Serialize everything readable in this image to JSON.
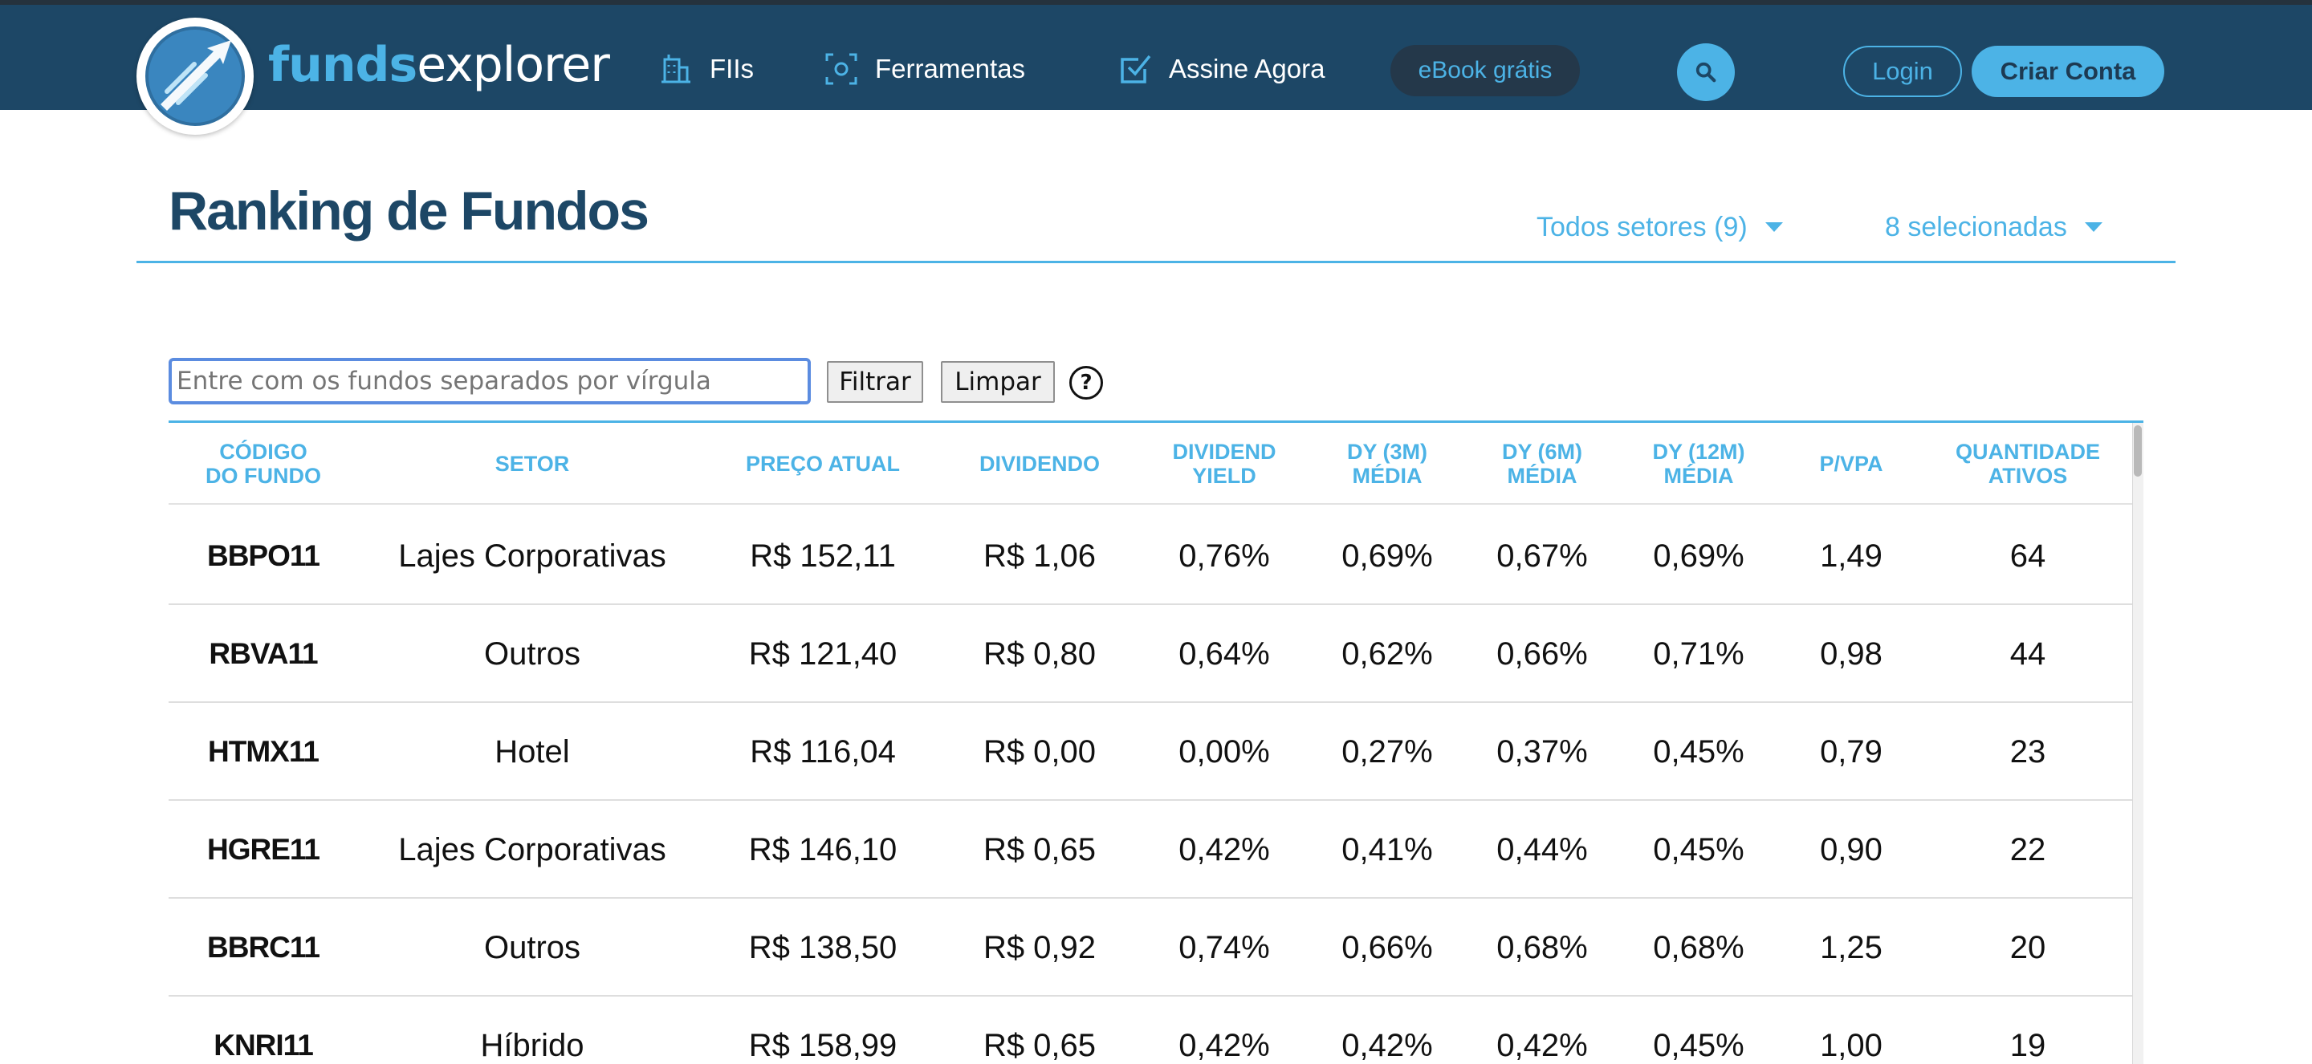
{
  "colors": {
    "header_bg": "#1d4766",
    "accent": "#4cb3e6",
    "title": "#1d4766",
    "ebook_bg": "#24384a"
  },
  "header": {
    "logo_bold": "funds",
    "logo_thin": "explorer",
    "logo_icon": "rocket-arrow-logo",
    "nav": [
      {
        "label": "FIIs",
        "icon": "building-icon"
      },
      {
        "label": "Ferramentas",
        "icon": "tools-target-icon"
      },
      {
        "label": "Assine Agora",
        "icon": "checkbox-icon"
      }
    ],
    "ebook_label": "eBook grátis",
    "search_icon": "search-icon",
    "login_label": "Login",
    "signup_label": "Criar Conta"
  },
  "page": {
    "title": "Ranking de Fundos",
    "sector_filter": "Todos setores (9)",
    "columns_filter": "8 selecionadas"
  },
  "filter": {
    "placeholder": "Entre com os fundos separados por vírgula",
    "value": "",
    "filter_label": "Filtrar",
    "clear_label": "Limpar",
    "help_symbol": "?"
  },
  "table": {
    "headers": [
      {
        "line1": "Código",
        "line2": "do fundo"
      },
      {
        "line1": "Setor",
        "line2": ""
      },
      {
        "line1": "Preço Atual",
        "line2": ""
      },
      {
        "line1": "Dividendo",
        "line2": ""
      },
      {
        "line1": "Dividend",
        "line2": "Yield"
      },
      {
        "line1": "DY (3M)",
        "line2": "Média"
      },
      {
        "line1": "DY (6M)",
        "line2": "Média"
      },
      {
        "line1": "DY (12M)",
        "line2": "Média"
      },
      {
        "line1": "P/VPA",
        "line2": ""
      },
      {
        "line1": "Quantidade",
        "line2": "Ativos"
      }
    ],
    "rows": [
      [
        "BBPO11",
        "Lajes Corporativas",
        "R$ 152,11",
        "R$ 1,06",
        "0,76%",
        "0,69%",
        "0,67%",
        "0,69%",
        "1,49",
        "64"
      ],
      [
        "RBVA11",
        "Outros",
        "R$ 121,40",
        "R$ 0,80",
        "0,64%",
        "0,62%",
        "0,66%",
        "0,71%",
        "0,98",
        "44"
      ],
      [
        "HTMX11",
        "Hotel",
        "R$ 116,04",
        "R$ 0,00",
        "0,00%",
        "0,27%",
        "0,37%",
        "0,45%",
        "0,79",
        "23"
      ],
      [
        "HGRE11",
        "Lajes Corporativas",
        "R$ 146,10",
        "R$ 0,65",
        "0,42%",
        "0,41%",
        "0,44%",
        "0,45%",
        "0,90",
        "22"
      ],
      [
        "BBRC11",
        "Outros",
        "R$ 138,50",
        "R$ 0,92",
        "0,74%",
        "0,66%",
        "0,68%",
        "0,68%",
        "1,25",
        "20"
      ],
      [
        "KNRI11",
        "Híbrido",
        "R$ 158,99",
        "R$ 0,65",
        "0,42%",
        "0,42%",
        "0,42%",
        "0,45%",
        "1,00",
        "19"
      ]
    ]
  }
}
